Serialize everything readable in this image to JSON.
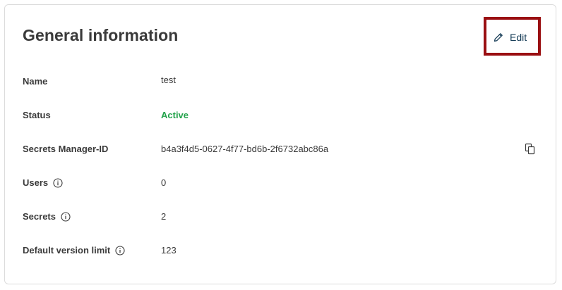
{
  "card": {
    "title": "General information",
    "edit_label": "Edit"
  },
  "fields": [
    {
      "label": "Name",
      "value": "test"
    },
    {
      "label": "Status",
      "value": "Active",
      "value_color": "#22a24a"
    },
    {
      "label": "Secrets Manager-ID",
      "value": "b4a3f4d5-0627-4f77-bd6b-2f6732abc86a"
    },
    {
      "label": "Users",
      "value": "0"
    },
    {
      "label": "Secrets",
      "value": "2"
    },
    {
      "label": "Default version limit",
      "value": "123"
    }
  ],
  "icons": {
    "edit": "pencil-icon",
    "info": "info-icon",
    "copy": "copy-icon"
  },
  "colors": {
    "highlight_border": "#9a0f12",
    "active_status": "#22a24a",
    "edit_text": "#163c57"
  }
}
